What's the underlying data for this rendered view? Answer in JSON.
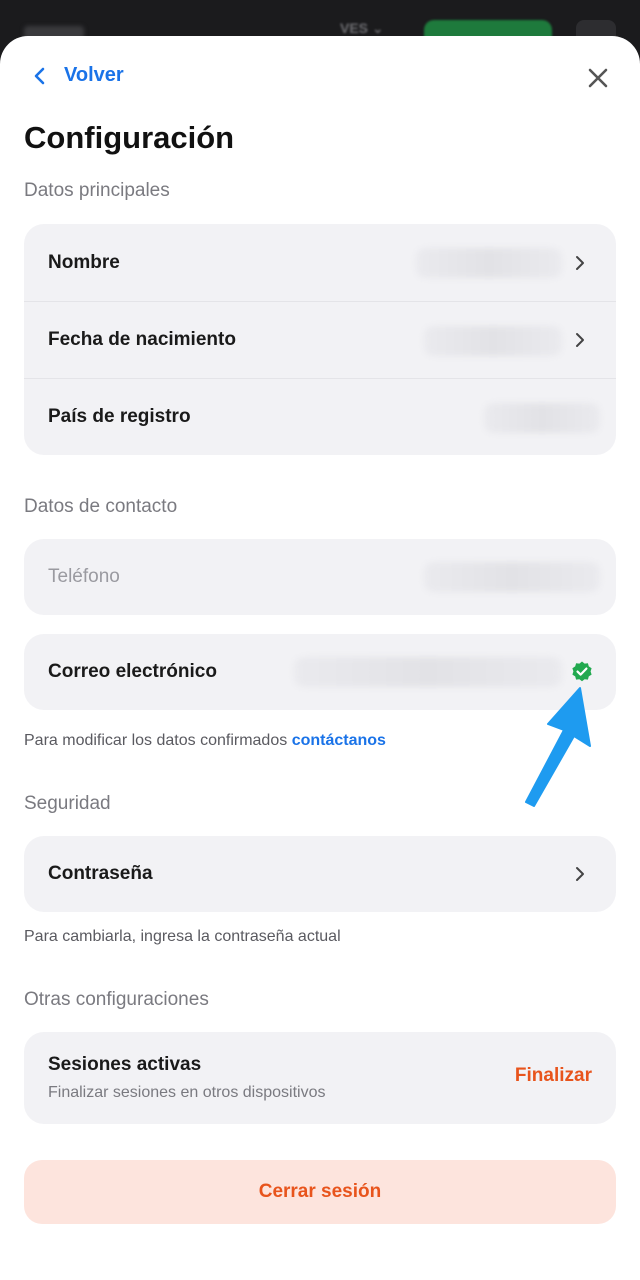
{
  "topbar": {
    "currency": "VES ⌄"
  },
  "header": {
    "back_label": "Volver",
    "title": "Configuración"
  },
  "sections": {
    "main": {
      "label": "Datos principales",
      "rows": [
        {
          "label": "Nombre"
        },
        {
          "label": "Fecha de nacimiento"
        },
        {
          "label": "País de registro"
        }
      ]
    },
    "contact": {
      "label": "Datos de contacto",
      "phone": "Teléfono",
      "email": "Correo electrónico",
      "helper_text": "Para modificar los datos confirmados",
      "helper_link": "contáctanos"
    },
    "security": {
      "label": "Seguridad",
      "password": "Contraseña",
      "helper_text": "Para cambiarla, ingresa la contraseña actual"
    },
    "other": {
      "label": "Otras configuraciones",
      "sessions_title": "Sesiones activas",
      "sessions_subtitle": "Finalizar sesiones en otros dispositivos",
      "sessions_action": "Finalizar"
    }
  },
  "logout_label": "Cerrar sesión",
  "colors": {
    "accent": "#1a73e8",
    "danger": "#e8541c",
    "verified": "#22a94f",
    "annotation_arrow": "#1e9bf0"
  }
}
